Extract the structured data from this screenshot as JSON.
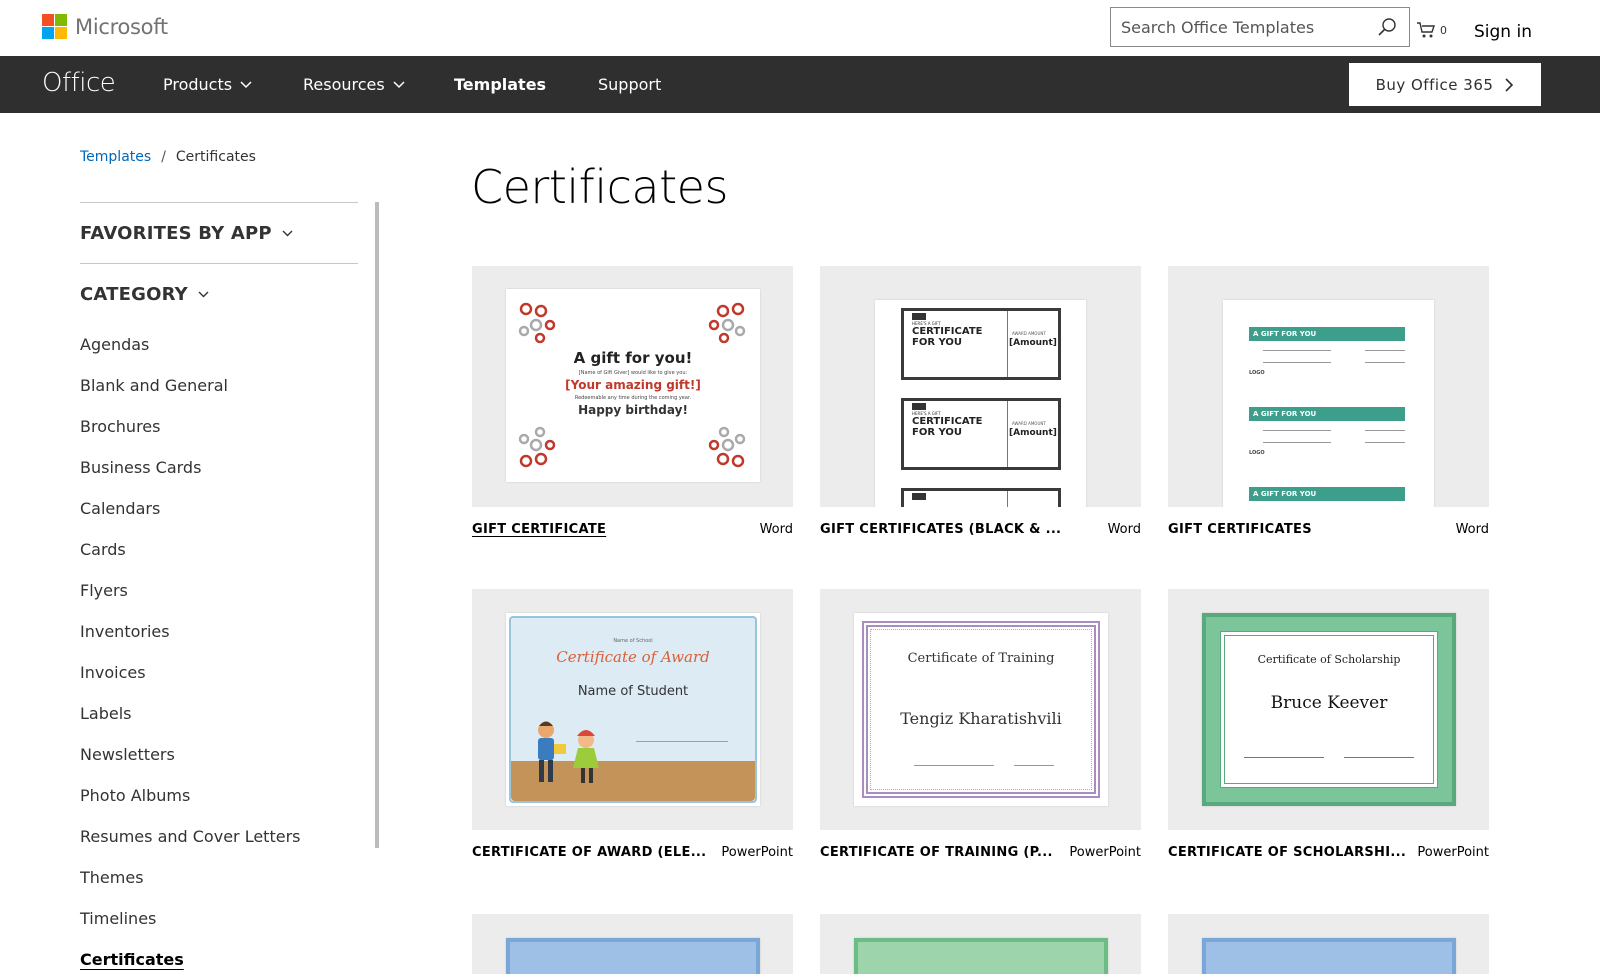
{
  "brand": {
    "name": "Microsoft",
    "colors": [
      "#f25022",
      "#7fba00",
      "#00a4ef",
      "#ffb900"
    ]
  },
  "search": {
    "placeholder": "Search Office Templates",
    "icon": "search-icon"
  },
  "cart": {
    "count": "0",
    "icon": "cart-icon"
  },
  "signin": "Sign in",
  "nav": {
    "office": "Office",
    "items": [
      {
        "label": "Products",
        "dropdown": true
      },
      {
        "label": "Resources",
        "dropdown": true
      },
      {
        "label": "Templates",
        "active": true
      },
      {
        "label": "Support"
      }
    ],
    "buy": "Buy Office 365"
  },
  "breadcrumb": {
    "root": "Templates",
    "sep": "/",
    "current": "Certificates"
  },
  "sidebar": {
    "favorites": "FAVORITES BY APP",
    "category": "CATEGORY",
    "items": [
      "Agendas",
      "Blank and General",
      "Brochures",
      "Business Cards",
      "Calendars",
      "Cards",
      "Flyers",
      "Inventories",
      "Invoices",
      "Labels",
      "Newsletters",
      "Photo Albums",
      "Resumes and Cover Letters",
      "Themes",
      "Timelines",
      "Certificates"
    ],
    "active": "Certificates"
  },
  "page_title": "Certificates",
  "templates": [
    {
      "name": "GIFT CERTIFICATE",
      "app": "Word",
      "preview": {
        "title": "A gift for you!",
        "from": "[Name of Gift Giver] would like to give you:",
        "gift": "[Your amazing gift!]",
        "note": "Redeemable any time during the coming year.",
        "closing": "Happy birthday!"
      }
    },
    {
      "name": "GIFT CERTIFICATES (BLACK & ...",
      "app": "Word",
      "preview": {
        "tag": "HERE'S A GIFT",
        "title": "CERTIFICATE FOR YOU",
        "amount_label": "AWARD AMOUNT",
        "amount": "[Amount]"
      }
    },
    {
      "name": "GIFT CERTIFICATES",
      "app": "Word",
      "preview": {
        "banner": "A GIFT FOR YOU",
        "logo": "LOGO"
      }
    },
    {
      "name": "CERTIFICATE OF AWARD (ELE...",
      "app": "PowerPoint",
      "preview": {
        "school": "Name of School",
        "title": "Certificate of Award",
        "student": "Name of Student"
      }
    },
    {
      "name": "CERTIFICATE OF TRAINING (P...",
      "app": "PowerPoint",
      "preview": {
        "title": "Certificate of Training",
        "recipient": "Tengiz Kharatishvili"
      }
    },
    {
      "name": "CERTIFICATE OF SCHOLARSHI...",
      "app": "PowerPoint",
      "preview": {
        "title": "Certificate of Scholarship",
        "recipient": "Bruce Keever"
      }
    }
  ]
}
